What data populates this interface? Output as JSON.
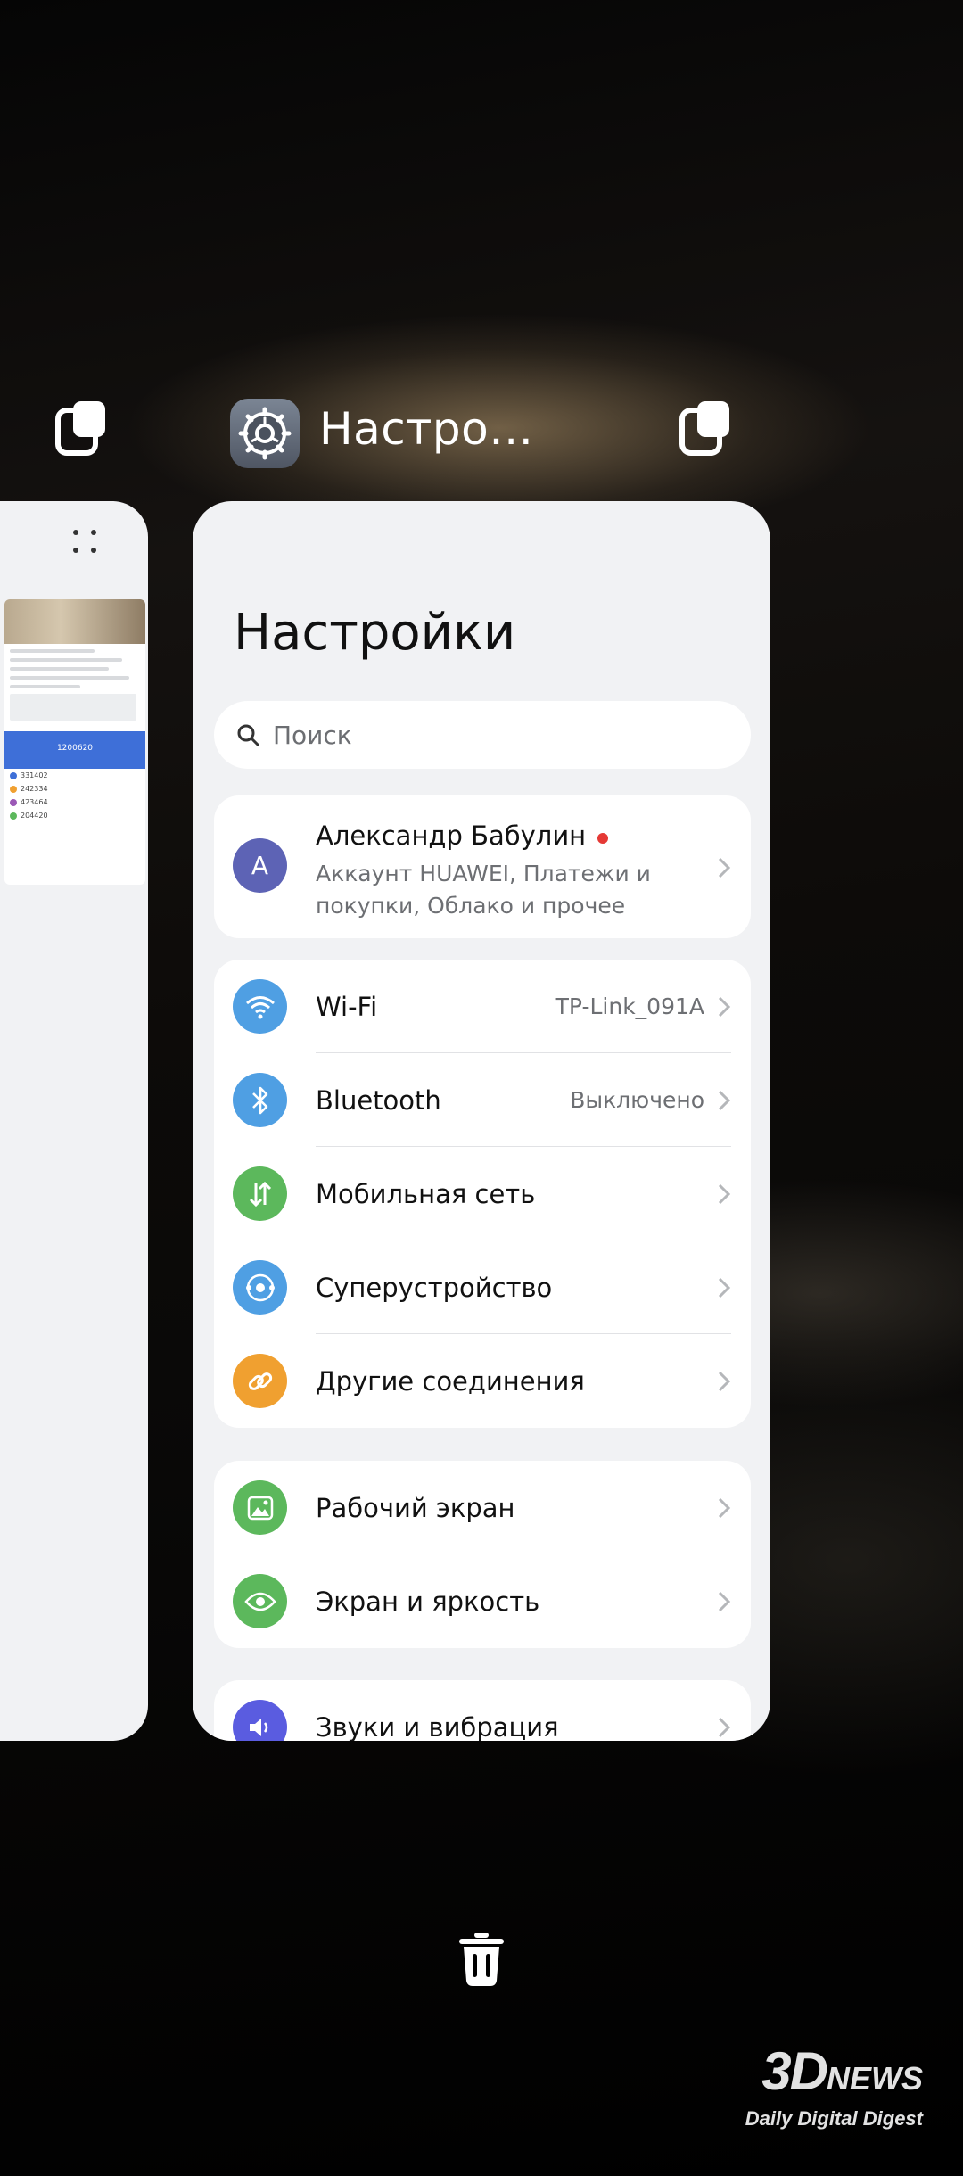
{
  "recents": {
    "current_app": {
      "title": "Настро…",
      "icon": "settings-gear-icon"
    },
    "previous_app": {
      "icon": "split-screen-icon"
    }
  },
  "settings": {
    "title": "Настройки",
    "search": {
      "placeholder": "Поиск",
      "icon": "search-icon"
    },
    "account": {
      "avatar_letter": "A",
      "name": "Александр Бабулин",
      "subtitle": "Аккаунт HUAWEI, Платежи и покупки, Облако и прочее",
      "notification_dot_color": "#e53935"
    },
    "connections": [
      {
        "label": "Wi-Fi",
        "value": "TP-Link_091A",
        "icon": "wifi-icon",
        "color": "#4f9fe3"
      },
      {
        "label": "Bluetooth",
        "value": "Выключено",
        "icon": "bluetooth-icon",
        "color": "#4f9fe3"
      },
      {
        "label": "Мобильная сеть",
        "value": "",
        "icon": "mobile-data-icon",
        "color": "#5cb85c"
      },
      {
        "label": "Суперустройство",
        "value": "",
        "icon": "super-device-icon",
        "color": "#4f9fe3"
      },
      {
        "label": "Другие соединения",
        "value": "",
        "icon": "link-icon",
        "color": "#f0a030"
      }
    ],
    "display": [
      {
        "label": "Рабочий экран",
        "icon": "home-screen-icon",
        "color": "#5cb85c"
      },
      {
        "label": "Экран и яркость",
        "icon": "eye-icon",
        "color": "#5cb85c"
      }
    ],
    "sound": [
      {
        "label": "Звуки и вибрация",
        "icon": "speaker-icon",
        "color": "#5a5ce0"
      }
    ]
  },
  "preview_left": {
    "banner_value": "1200620",
    "scores": [
      "331402",
      "242334",
      "423464",
      "204420"
    ]
  },
  "actions": {
    "clear_all_icon": "trash-icon"
  },
  "watermark": {
    "logo_big": "3D",
    "logo_small": "NEWS",
    "tagline": "Daily Digital Digest"
  }
}
